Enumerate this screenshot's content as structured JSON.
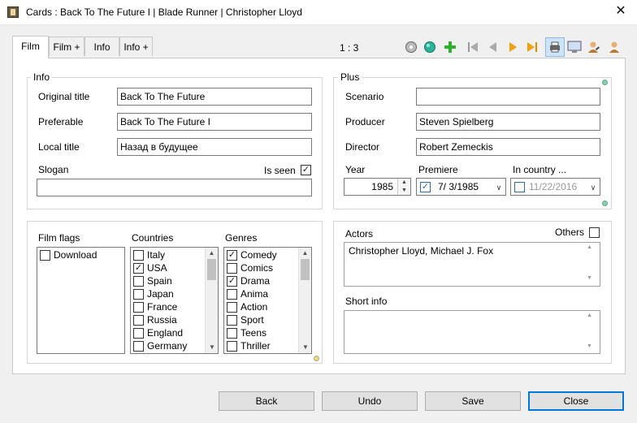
{
  "window": {
    "title": "Cards : Back To The Future I | Blade Runner | Christopher Lloyd",
    "close_glyph": "✕"
  },
  "tabs": [
    {
      "label": "Film",
      "active": true
    },
    {
      "label": "Film +"
    },
    {
      "label": "Info"
    },
    {
      "label": "Info +"
    }
  ],
  "toolbar": {
    "record_counter": "1 : 3",
    "icons": [
      "film-reel-icon",
      "green-ball-icon",
      "add-icon",
      "first-record-icon",
      "previous-record-icon",
      "next-record-icon",
      "last-record-icon",
      "print-icon",
      "monitor-icon",
      "user-edit-icon",
      "user-icon"
    ]
  },
  "info_group": {
    "title": "Info",
    "original_title_label": "Original title",
    "original_title_value": "Back To The Future",
    "preferable_label": "Preferable",
    "preferable_value": "Back To The Future I",
    "local_title_label": "Local title",
    "local_title_value": "Назад в будущее",
    "slogan_label": "Slogan",
    "slogan_value": "",
    "is_seen_label": "Is seen",
    "is_seen_checked": true
  },
  "plus_group": {
    "title": "Plus",
    "scenario_label": "Scenario",
    "scenario_value": "",
    "producer_label": "Producer",
    "producer_value": "Steven Spielberg",
    "director_label": "Director",
    "director_value": "Robert Zemeckis",
    "year_label": "Year",
    "year_value": "1985",
    "premiere_label": "Premiere",
    "premiere_value": "7/  3/1985",
    "premiere_checked": true,
    "in_country_label": "In country ...",
    "in_country_value": "11/22/2016",
    "in_country_checked": false
  },
  "flags_group": {
    "film_flags_label": "Film flags",
    "film_flags": [
      {
        "label": "Download",
        "checked": false
      }
    ],
    "countries_label": "Countries",
    "countries": [
      {
        "label": "Italy",
        "checked": false
      },
      {
        "label": "USA",
        "checked": true
      },
      {
        "label": "Spain",
        "checked": false
      },
      {
        "label": "Japan",
        "checked": false
      },
      {
        "label": "France",
        "checked": false
      },
      {
        "label": "Russia",
        "checked": false
      },
      {
        "label": "England",
        "checked": false
      },
      {
        "label": "Germany",
        "checked": false
      }
    ],
    "genres_label": "Genres",
    "genres": [
      {
        "label": "Comedy",
        "checked": true
      },
      {
        "label": "Comics",
        "checked": false
      },
      {
        "label": "Drama",
        "checked": true
      },
      {
        "label": "Anima",
        "checked": false
      },
      {
        "label": "Action",
        "checked": false
      },
      {
        "label": "Sport",
        "checked": false
      },
      {
        "label": "Teens",
        "checked": false
      },
      {
        "label": "Thriller",
        "checked": false
      }
    ]
  },
  "actors_group": {
    "actors_label": "Actors",
    "actors_value": "Christopher Lloyd, Michael J. Fox",
    "others_label": "Others",
    "others_checked": false,
    "short_info_label": "Short info",
    "short_info_value": ""
  },
  "buttons": {
    "back": "Back",
    "undo": "Undo",
    "save": "Save",
    "close": "Close"
  },
  "check_glyph": "✓"
}
